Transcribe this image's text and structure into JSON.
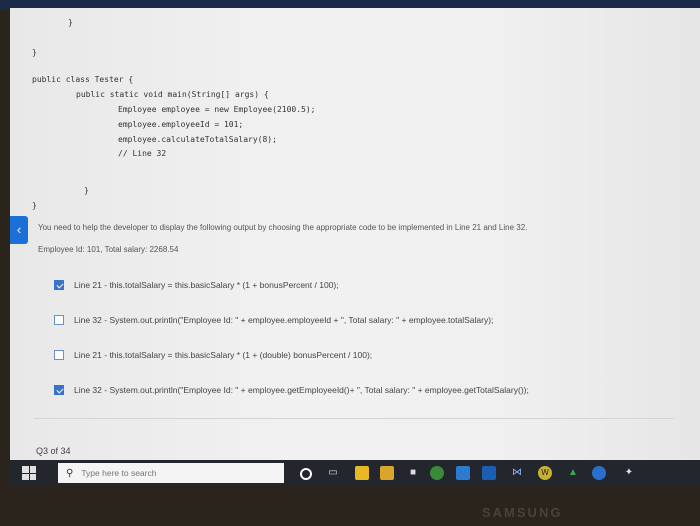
{
  "code": {
    "brace_1": "}",
    "brace_2": "}",
    "class_decl": "public class Tester {",
    "main_decl": "public static void main(String[] args) {",
    "line_new": "Employee employee = new Employee(2100.5);",
    "line_id": "employee.employeeId = 101;",
    "line_calc": "employee.calculateTotalSalary(8);",
    "line_comment": "// Line 32",
    "brace_3": "}",
    "brace_4": "}"
  },
  "question": {
    "prompt": "You need to help the developer to display the following output by choosing the appropriate code to be implemented in Line 21 and Line 32.",
    "output": "Employee Id: 101, Total salary: 2268.54"
  },
  "options": [
    {
      "label": "Line 21 - this.totalSalary = this.basicSalary * (1 + bonusPercent / 100);",
      "checked": true
    },
    {
      "label": "Line 32 - System.out.println(\"Employee Id: \" + employee.employeeId + \", Total salary: \" + employee.totalSalary);",
      "checked": false
    },
    {
      "label": "Line 21 - this.totalSalary = this.basicSalary * (1 + (double) bonusPercent / 100);",
      "checked": false
    },
    {
      "label": "Line 32 - System.out.println(\"Employee Id: \" + employee.getEmployeeId()+ \", Total salary: \" + employee.getTotalSalary());",
      "checked": true
    }
  ],
  "footer": {
    "counter": "Q3 of 34"
  },
  "taskbar": {
    "search_placeholder": "Type here to search",
    "icons": [
      "cortana-icon",
      "task-view-icon",
      "file-explorer-icon",
      "store-icon",
      "lock-icon",
      "chrome-icon",
      "app-icon",
      "mail-icon",
      "vscode-icon",
      "word-icon",
      "green-app-icon",
      "edge-icon",
      "translate-icon"
    ]
  },
  "device": {
    "brand": "SAMSUNG"
  },
  "colors": {
    "accent": "#1d6fd8",
    "checked": "#3a73c9",
    "taskbar": "#23262c"
  }
}
